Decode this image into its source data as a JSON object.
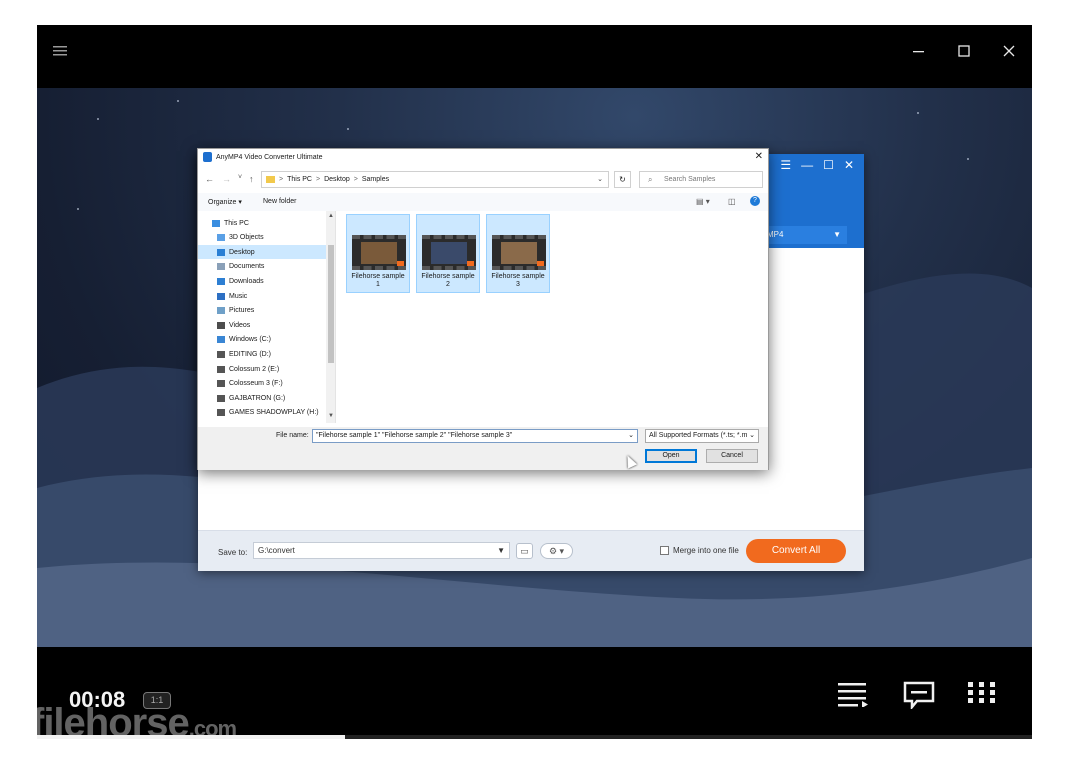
{
  "dialog": {
    "title": "AnyMP4 Video Converter Ultimate",
    "close_glyph": "✕",
    "nav": {
      "back": "←",
      "forward": "→",
      "recent": "˅",
      "up": "↑"
    },
    "breadcrumb": [
      "This PC",
      "Desktop",
      "Samples"
    ],
    "breadcrumb_sep": ">",
    "refresh_glyph": "↻",
    "search_placeholder": "Search Samples",
    "toolbar": {
      "organize": "Organize ▾",
      "new_folder": "New folder",
      "view_glyph": "▤ ▾",
      "pane_glyph": "◫",
      "help_glyph": "?"
    },
    "nav_items": [
      {
        "label": "This PC",
        "icon": "computer-icon",
        "color": "#3b8ee0",
        "level": 0
      },
      {
        "label": "3D Objects",
        "icon": "cube-icon",
        "color": "#5aa0e6",
        "level": 1
      },
      {
        "label": "Desktop",
        "icon": "desktop-icon",
        "color": "#2a7fd4",
        "level": 1,
        "selected": true
      },
      {
        "label": "Documents",
        "icon": "document-icon",
        "color": "#8aa0b8",
        "level": 1
      },
      {
        "label": "Downloads",
        "icon": "download-icon",
        "color": "#2d7fd3",
        "level": 1
      },
      {
        "label": "Music",
        "icon": "music-icon",
        "color": "#2d6fc3",
        "level": 1
      },
      {
        "label": "Pictures",
        "icon": "picture-icon",
        "color": "#6fa0c8",
        "level": 1
      },
      {
        "label": "Videos",
        "icon": "video-icon",
        "color": "#4d4d4d",
        "level": 1
      },
      {
        "label": "Windows (C:)",
        "icon": "drive-icon",
        "color": "#3a86d4",
        "level": 1
      },
      {
        "label": "EDITING (D:)",
        "icon": "drive-icon",
        "color": "#555555",
        "level": 1
      },
      {
        "label": "Colossum 2 (E:)",
        "icon": "drive-icon",
        "color": "#555555",
        "level": 1
      },
      {
        "label": "Colosseum 3 (F:)",
        "icon": "drive-icon",
        "color": "#555555",
        "level": 1
      },
      {
        "label": "GAJBATRON (G:)",
        "icon": "drive-icon",
        "color": "#555555",
        "level": 1
      },
      {
        "label": "GAMES SHADOWPLAY (H:)",
        "icon": "drive-icon",
        "color": "#555555",
        "level": 1
      }
    ],
    "scroll_up": "▲",
    "scroll_down": "▼",
    "files": [
      {
        "label": "Filehorse sample 1",
        "tint": "#7a5a3a"
      },
      {
        "label": "Filehorse sample 2",
        "tint": "#3a4a6a"
      },
      {
        "label": "Filehorse sample 3",
        "tint": "#8a6a4a"
      }
    ],
    "file_name_label": "File name:",
    "file_name_value": "\"Filehorse sample 1\" \"Filehorse sample 2\" \"Filehorse sample 3\"",
    "format_value": "All Supported Formats (*.ts; *.m",
    "dropdown_glyph": "⌄",
    "open_label": "Open",
    "cancel_label": "Cancel"
  },
  "app": {
    "window_controls": [
      "☰",
      "—",
      "☐",
      "✕"
    ],
    "format_label": "MP4",
    "format_arrow": "▼",
    "save_to_label": "Save to:",
    "save_path": "G:\\convert",
    "path_dropdown": "▼",
    "folder_glyph": "▭",
    "settings_glyph": "⚙ ▾",
    "merge_label": "Merge into one file",
    "convert_label": "Convert All",
    "accent": "#f16a1e",
    "header_color": "#1d6fcf"
  },
  "player": {
    "menu_glyph": "☰",
    "minimize_glyph": "—",
    "maximize_glyph": "☐",
    "close_glyph": "✕",
    "timecode": "00:08",
    "speed_badge": "1:1",
    "watermark": "filehorse",
    "watermark_suffix": ".com",
    "progress": 0.31
  }
}
